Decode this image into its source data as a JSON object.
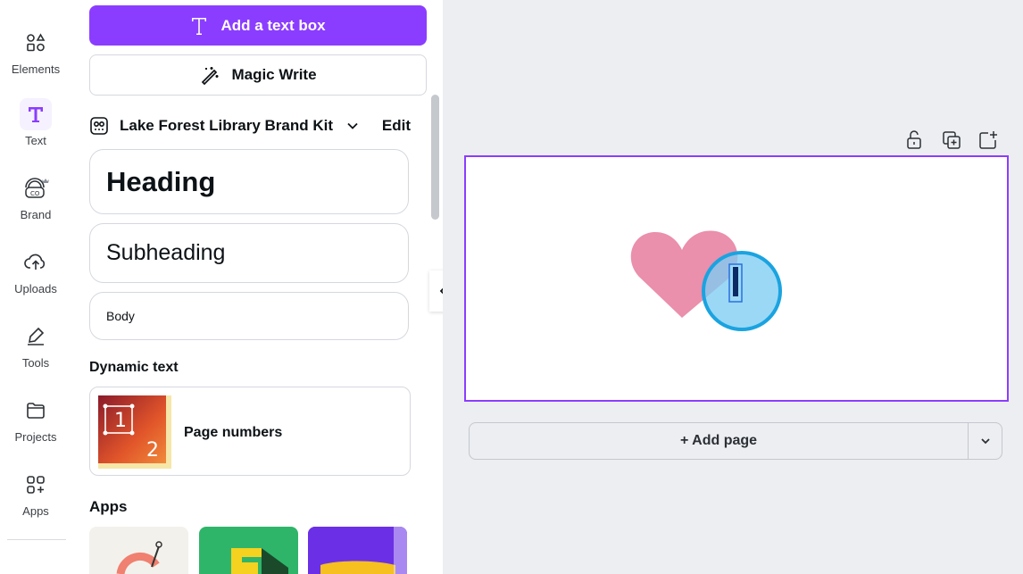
{
  "rail": {
    "items": [
      {
        "label": "Elements",
        "icon": "elements-icon"
      },
      {
        "label": "Text",
        "icon": "text-icon"
      },
      {
        "label": "Brand",
        "icon": "brand-icon"
      },
      {
        "label": "Uploads",
        "icon": "upload-cloud-icon"
      },
      {
        "label": "Tools",
        "icon": "tools-icon"
      },
      {
        "label": "Projects",
        "icon": "folder-icon"
      },
      {
        "label": "Apps",
        "icon": "apps-icon"
      }
    ],
    "active": "Text"
  },
  "panel": {
    "add_text_box": "Add a text box",
    "magic_write": "Magic Write",
    "brand_kit": {
      "name": "Lake Forest Library Brand Kit",
      "edit": "Edit"
    },
    "styles": {
      "heading": "Heading",
      "subheading": "Subheading",
      "body": "Body"
    },
    "dynamic_text_title": "Dynamic text",
    "page_numbers": {
      "label": "Page numbers",
      "digits": [
        "1",
        "2"
      ]
    },
    "apps_title": "Apps"
  },
  "canvas": {
    "add_page": "+ Add page"
  },
  "colors": {
    "accent": "#8b3dff",
    "heart": "#ea8fac",
    "cursor_circle": "#7fcdf2"
  }
}
